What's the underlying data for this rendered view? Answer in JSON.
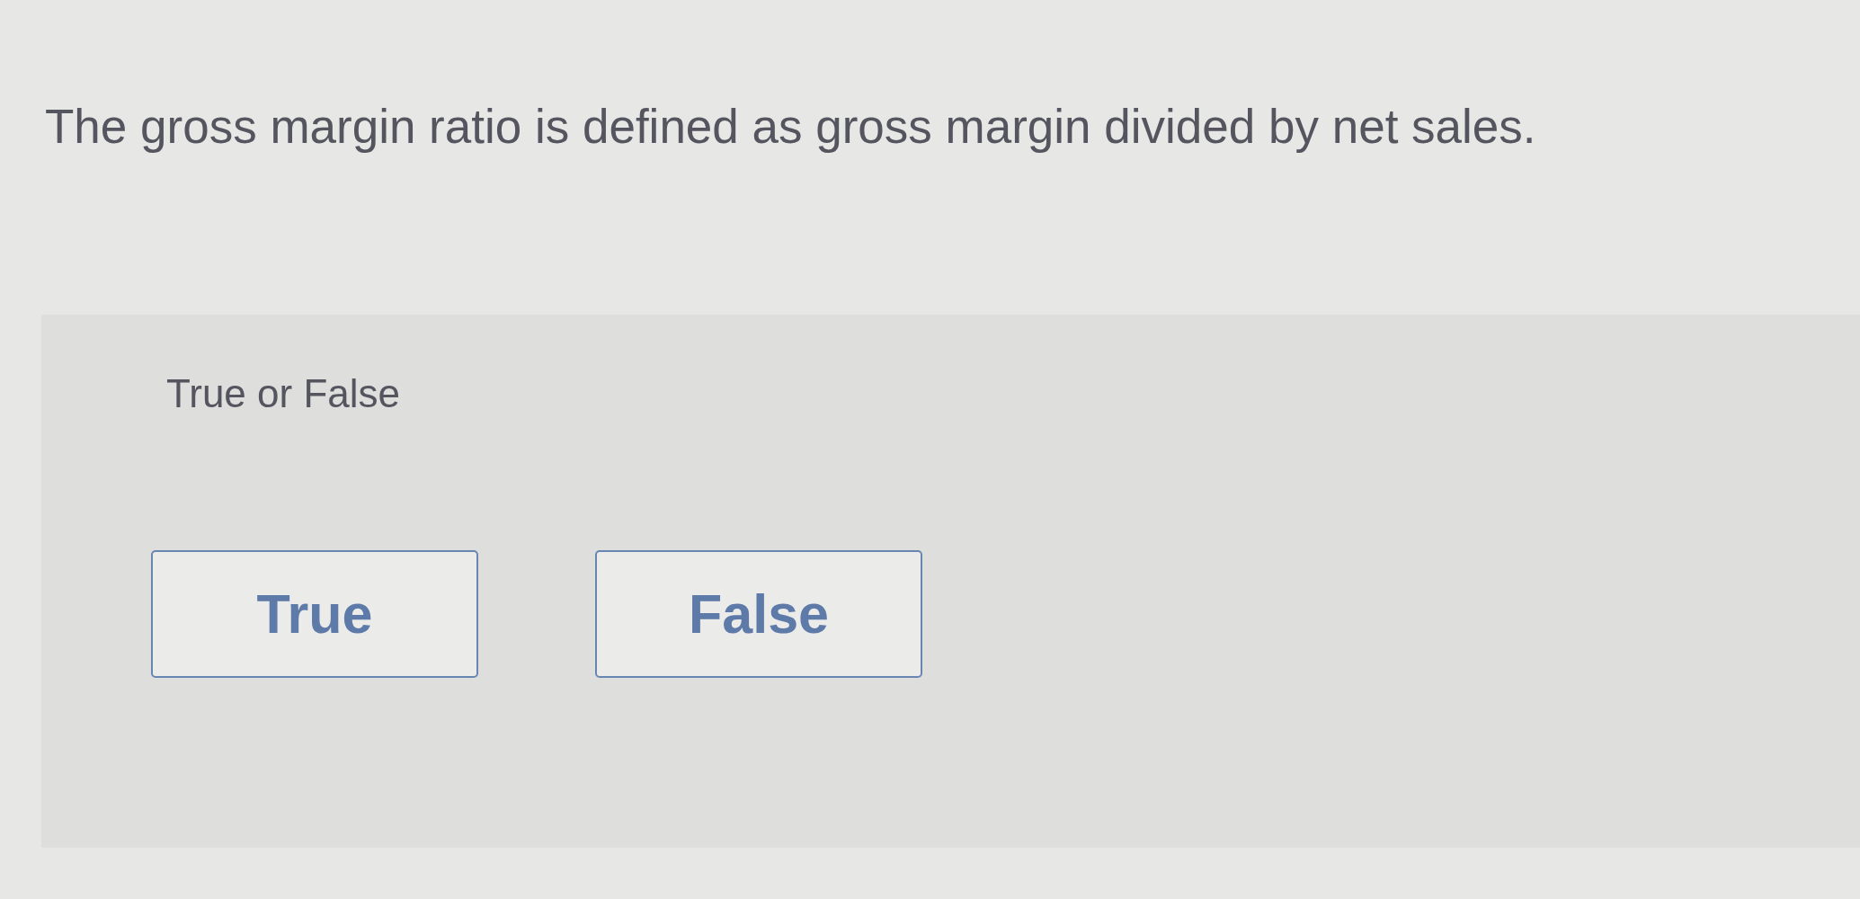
{
  "question": {
    "text": "The gross margin ratio is defined as gross margin divided by net sales."
  },
  "answer_panel": {
    "prompt": "True or False",
    "options": [
      {
        "label": "True",
        "selected": false
      },
      {
        "label": "False",
        "selected": false
      }
    ]
  }
}
